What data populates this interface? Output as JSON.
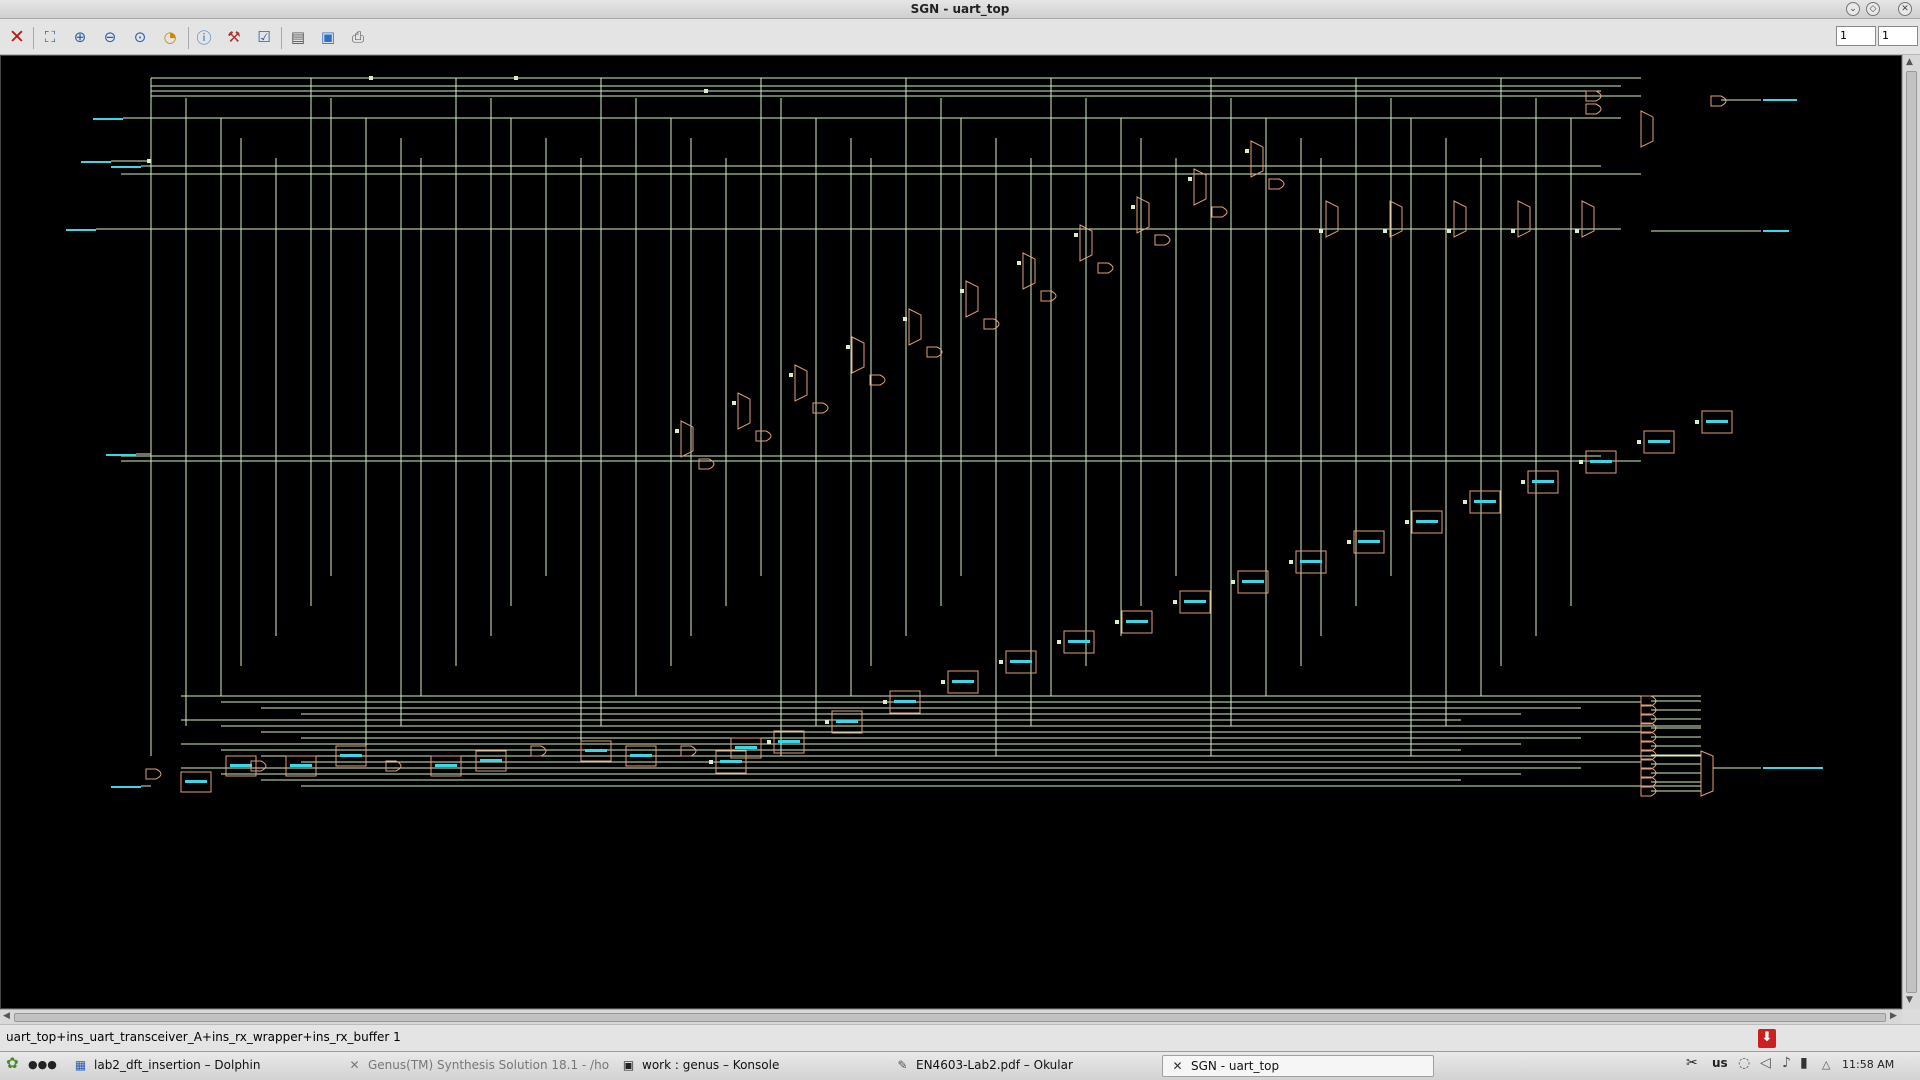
{
  "window": {
    "title": "SGN - uart_top"
  },
  "toolbar": {
    "buttons": [
      {
        "name": "close-icon",
        "glyph": "✕"
      },
      {
        "name": "zoom-fit-icon",
        "glyph": "⛶"
      },
      {
        "name": "zoom-in-icon",
        "glyph": "🔍"
      },
      {
        "name": "zoom-out-icon",
        "glyph": "🔍"
      },
      {
        "name": "zoom-area-icon",
        "glyph": "🔍"
      },
      {
        "name": "zoom-previous-icon",
        "glyph": "◔"
      },
      {
        "name": "info-icon",
        "glyph": "ⓘ"
      },
      {
        "name": "trace-icon",
        "glyph": "⚒"
      },
      {
        "name": "select-icon",
        "glyph": "☑"
      },
      {
        "name": "document-icon",
        "glyph": "▤"
      },
      {
        "name": "save-icon",
        "glyph": "💾"
      },
      {
        "name": "print-icon",
        "glyph": "⎙"
      }
    ],
    "page_current": "1",
    "page_total": "1"
  },
  "schematic": {
    "background": "#000000",
    "wire_color": "#d6f0c2",
    "cell_color": "#e0a07a",
    "label_color": "#39d7e8"
  },
  "status": {
    "path": "uart_top+ins_uart_transceiver_A+ins_rx_wrapper+ins_rx_buffer 1"
  },
  "taskbar": {
    "tasks": [
      {
        "label": "lab2_dft_insertion – Dolphin",
        "icon": "folder-icon"
      },
      {
        "label": "Genus(TM) Synthesis Solution 18.1 - /ho",
        "icon": "genus-icon"
      },
      {
        "label": "work : genus – Konsole",
        "icon": "terminal-icon"
      },
      {
        "label": "EN4603-Lab2.pdf – Okular",
        "icon": "pdf-icon"
      },
      {
        "label": "SGN - uart_top",
        "icon": "sgn-icon"
      }
    ],
    "keyboard_layout": "us",
    "clock": "11:58 AM"
  }
}
